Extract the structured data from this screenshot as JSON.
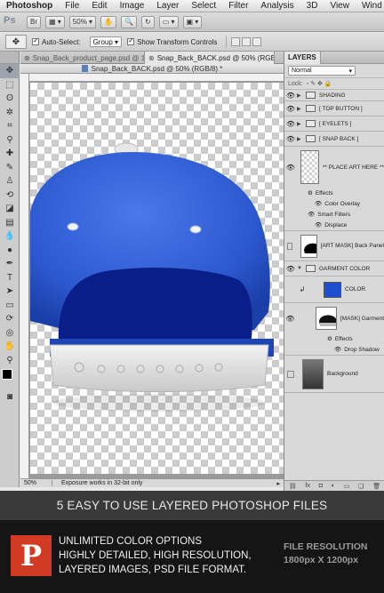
{
  "menubar": {
    "apple": "",
    "app_name": "Photoshop",
    "items": [
      "File",
      "Edit",
      "Image",
      "Layer",
      "Select",
      "Filter",
      "Analysis",
      "3D",
      "View",
      "Wind"
    ]
  },
  "appbar": {
    "logo": "Ps",
    "zoom": "50%"
  },
  "options": {
    "auto_select_label": "Auto-Select:",
    "auto_select_checked": true,
    "auto_select_value": "Group",
    "transform_label": "Show Transform Controls",
    "transform_checked": true
  },
  "document": {
    "tabs": [
      {
        "label": "Snap_Back_product_page.psd @ 1…",
        "active": false
      },
      {
        "label": "Snap_Back_BACK.psd @ 50% (RGB/…",
        "active": true
      }
    ],
    "window_title": "Snap_Back_BACK.psd @ 50% (RGB/8) *",
    "zoom": "50%",
    "status": "Exposure works in 32-bit only"
  },
  "layers_panel": {
    "title": "LAYERS",
    "blend_mode": "Normal",
    "lock_label": "Lock:",
    "groups": [
      "SHADING",
      "[ TOP BUTTON ]",
      "[ EYELETS ]",
      "[ SNAP BACK ]"
    ],
    "place_art": "** PLACE ART HERE **",
    "effects": "Effects",
    "color_overlay": "Color Overlay",
    "smart_filters": "Smart Filters",
    "displace": "Displace",
    "art_mask": "[ART MASK] Back Panel",
    "garment_color": "GARMENT COLOR",
    "color": "COLOR",
    "mask_garment": "[MASK] Garment",
    "effects2": "Effects",
    "drop_shadow": "Drop Shadow",
    "background": "Background",
    "color_swatch": "#1f4fd1"
  },
  "banner": {
    "text": "5 EASY TO USE LAYERED PHOTOSHOP FILES"
  },
  "footer": {
    "logo_letter": "P",
    "features": [
      "UNLIMITED COLOR OPTIONS",
      "HIGHLY DETAILED, HIGH RESOLUTION,",
      "LAYERED IMAGES, PSD FILE FORMAT."
    ],
    "resolution_label": "FILE RESOLUTION",
    "resolution_value": "1800px X 1200px"
  },
  "colors": {
    "cap_blue": "#2f5fd6",
    "cap_dark": "#0a1e8a",
    "brand_red": "#d13a23"
  }
}
